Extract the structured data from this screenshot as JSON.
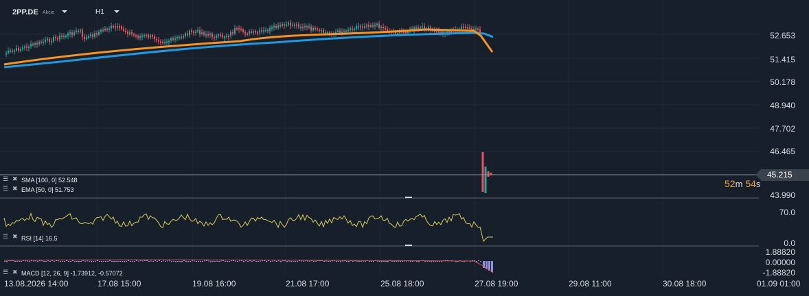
{
  "header": {
    "symbol": "2PP.DE",
    "instrument_type": "Akcie",
    "timeframe": "H1"
  },
  "price_axis": [
    "52.653",
    "51.415",
    "50.178",
    "48.940",
    "47.702",
    "46.465",
    "45.215",
    "43.990"
  ],
  "rsi_axis": [
    "70.0",
    "0.0"
  ],
  "macd_axis": [
    "1.88820",
    "0.00000",
    "-1.88820"
  ],
  "time_axis": [
    "13.08.2026 14:00",
    "17.08 15:00",
    "19.08 16:00",
    "21.08 17:00",
    "25.08 18:00",
    "27.08 19:00",
    "29.08 11:00",
    "30.08 18:00",
    "01.09 01:00"
  ],
  "current_price": "45.215",
  "timer": {
    "minutes": "52",
    "m_unit": "m",
    "seconds": "54",
    "s_unit": "s"
  },
  "indicators": {
    "sma": "SMA [100, 0] 52.548",
    "ema": "EMA [50, 0] 51.753",
    "rsi": "RSI [14] 16.5",
    "macd": "MACD [12, 26, 9] -1.73912, -0.57072"
  },
  "colors": {
    "sma": "#1e9be0",
    "ema": "#f7931e",
    "up": "#26a69a",
    "down": "#ef5060",
    "rsi": "#d6d05a",
    "macd_hist": "#9090e0",
    "macd_signal": "#e05050"
  }
}
